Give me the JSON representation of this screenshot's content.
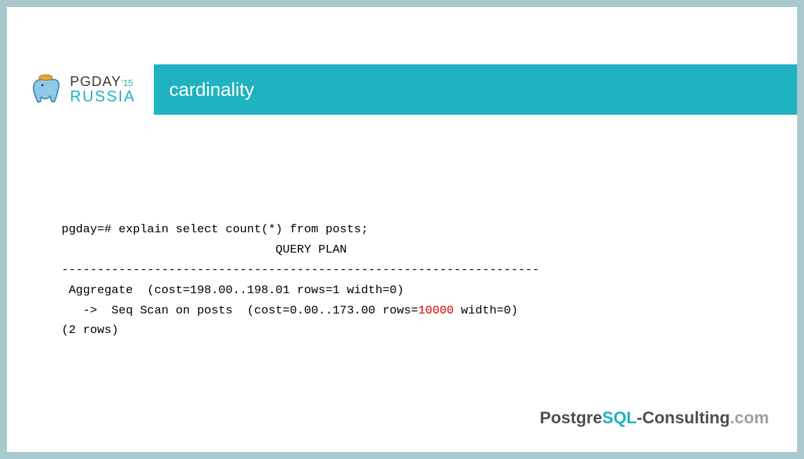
{
  "logo": {
    "line1": "PGDAY",
    "sup": "'15",
    "line2": "RUSSIA"
  },
  "title": "cardinality",
  "code": {
    "line1": "pgday=# explain select count(*) from posts;",
    "line2": "                              QUERY PLAN",
    "line3": "-------------------------------------------------------------------",
    "line4": " Aggregate  (cost=198.00..198.01 rows=1 width=0)",
    "line5a": "   ->  Seq Scan on posts  (cost=0.00..173.00 rows=",
    "line5_highlight": "10000",
    "line5b": " width=0)",
    "line6": "(2 rows)"
  },
  "footer": {
    "part1": "Postgre",
    "part2": "SQL",
    "part3": "-Consulting",
    "part4": ".com"
  }
}
